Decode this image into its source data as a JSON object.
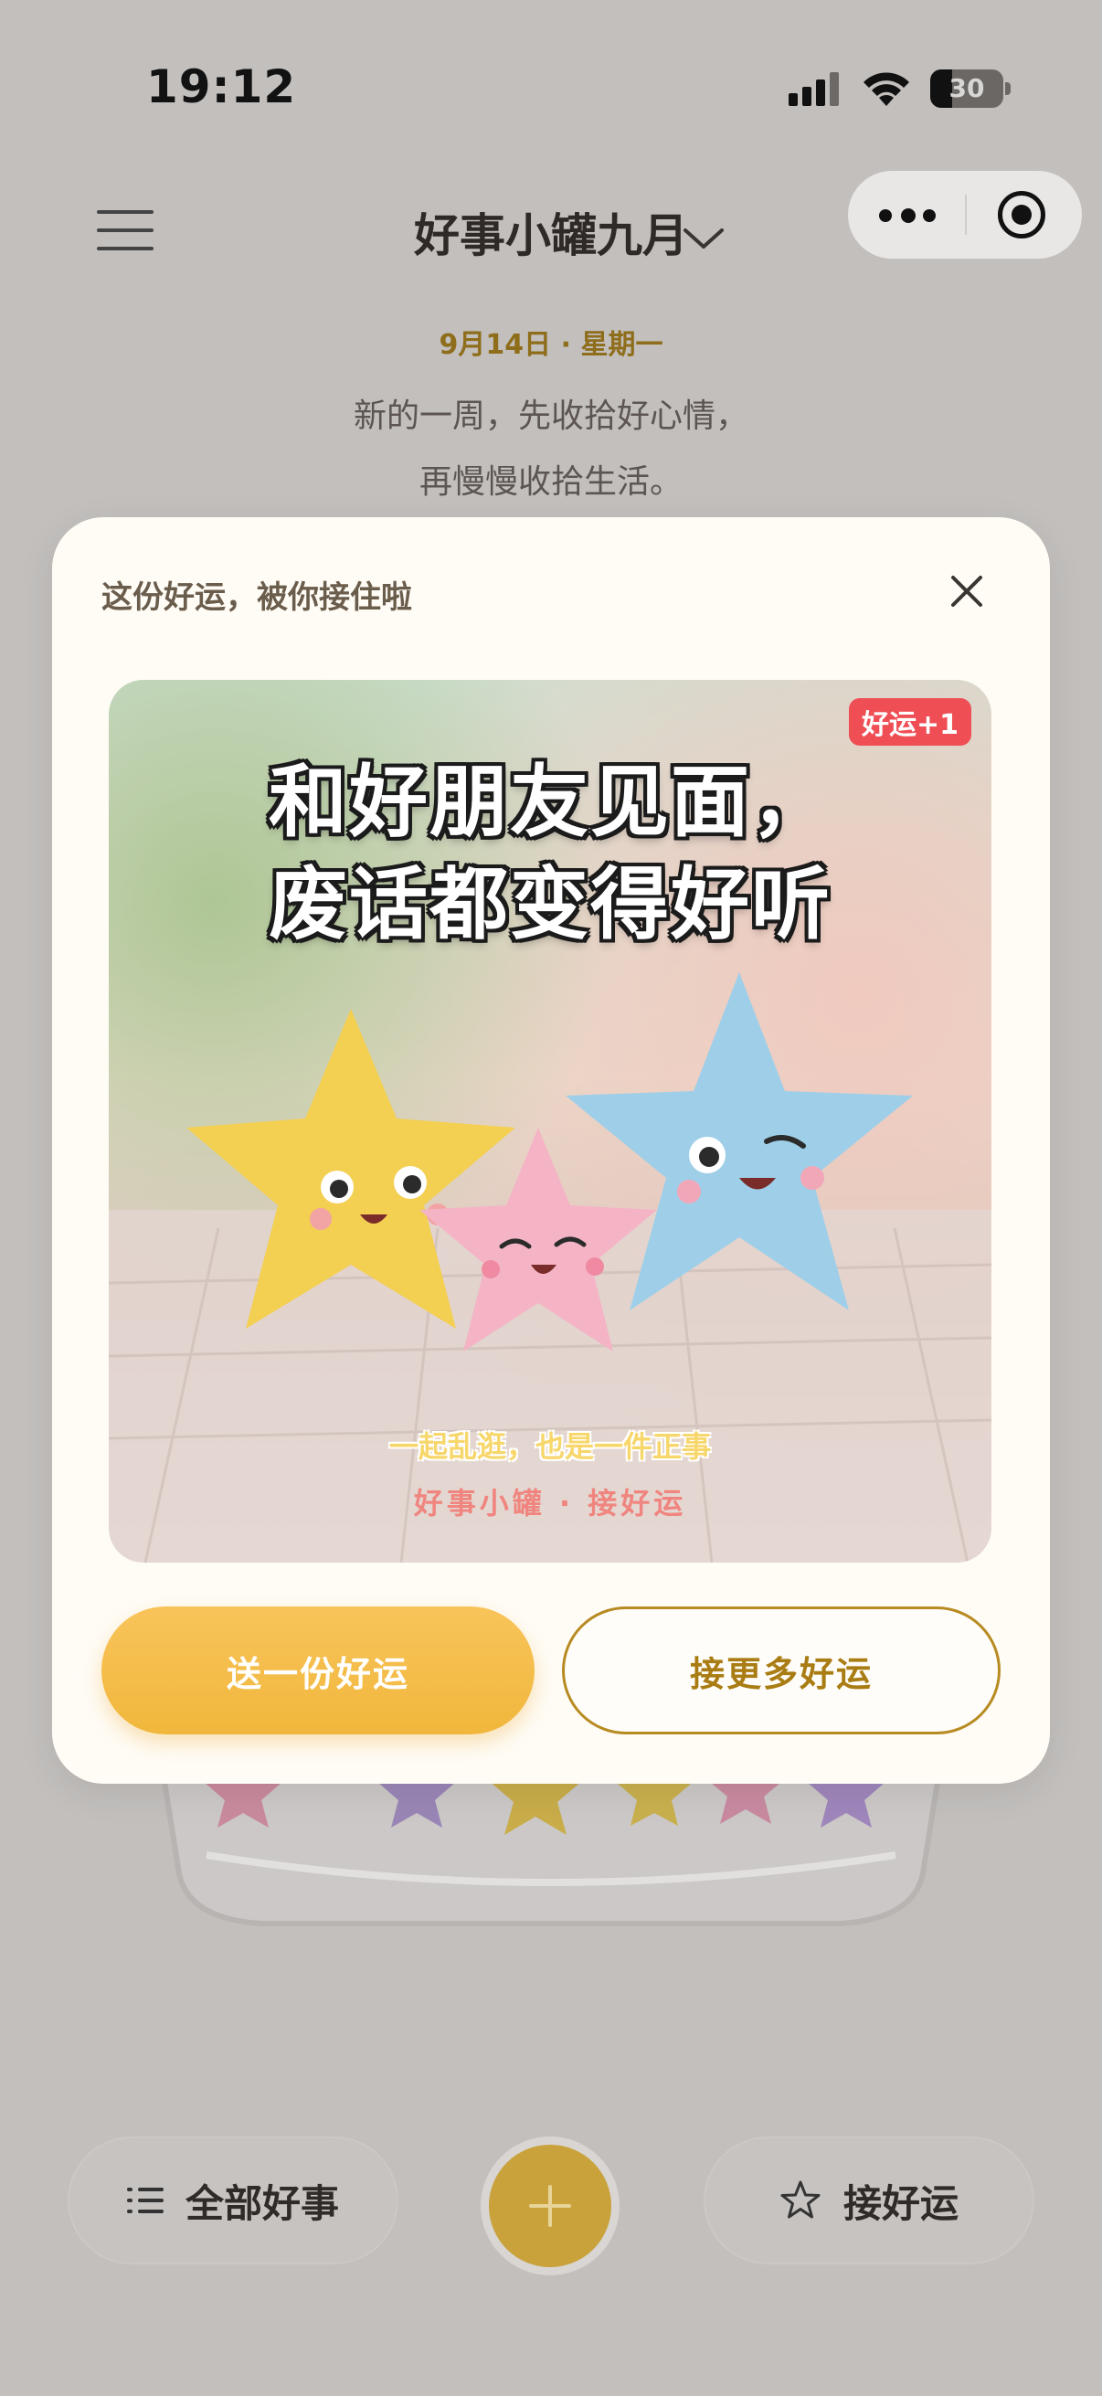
{
  "status_bar": {
    "time": "19:12",
    "battery": "30",
    "battery_level": 0.3
  },
  "header": {
    "title": "好事小罐九月",
    "date": "9月14日 · 星期一",
    "quote_line1": "新的一周，先收拾好心情，",
    "quote_line2": "再慢慢收拾生活。"
  },
  "modal": {
    "title": "这份好运，被你接住啦",
    "badge": "好运+1",
    "headline_line1": "和好朋友见面，",
    "headline_line2": "废话都变得好听",
    "sub_caption": "一起乱逛，也是一件正事",
    "brand_line": "好事小罐 · 接好运",
    "send_button": "送一份好运",
    "more_button": "接更多好运"
  },
  "bottom_bar": {
    "all_label": "全部好事",
    "luck_label": "接好运"
  },
  "colors": {
    "accent": "#F4BC48",
    "accent_text": "#A97D14",
    "badge": "#EF4E55",
    "page_dim": "#C2BFBD"
  },
  "icons": [
    "menu-icon",
    "chevron-down-icon",
    "more-icon",
    "target-icon",
    "close-icon",
    "list-icon",
    "star-icon",
    "plus-icon"
  ]
}
